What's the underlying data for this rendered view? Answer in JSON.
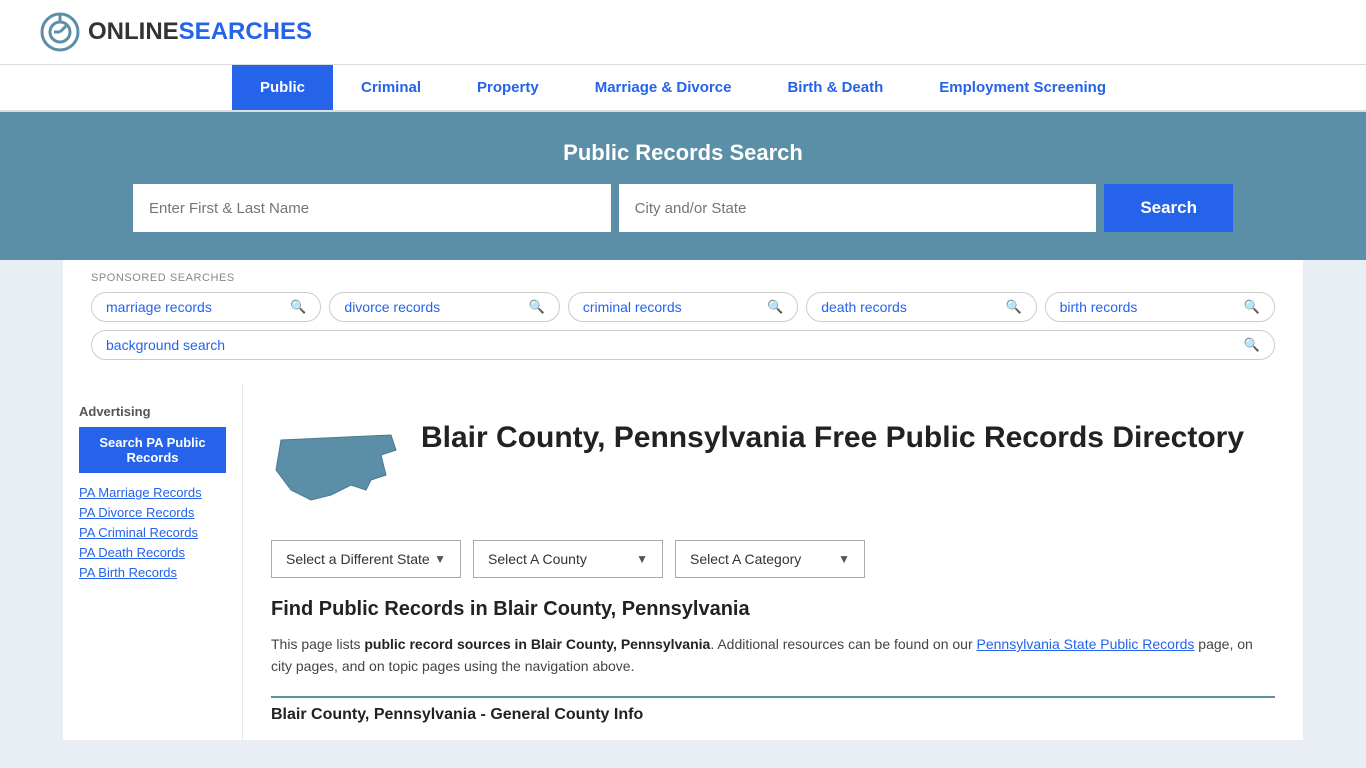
{
  "logo": {
    "text_online": "ONLINE",
    "text_searches": "SEARCHES"
  },
  "nav": {
    "items": [
      {
        "label": "Public",
        "active": true
      },
      {
        "label": "Criminal",
        "active": false
      },
      {
        "label": "Property",
        "active": false
      },
      {
        "label": "Marriage & Divorce",
        "active": false
      },
      {
        "label": "Birth & Death",
        "active": false
      },
      {
        "label": "Employment Screening",
        "active": false
      }
    ]
  },
  "hero": {
    "title": "Public Records Search",
    "name_placeholder": "Enter First & Last Name",
    "location_placeholder": "City and/or State",
    "search_button": "Search"
  },
  "sponsored": {
    "label": "SPONSORED SEARCHES",
    "pills": [
      "marriage records",
      "divorce records",
      "criminal records",
      "death records",
      "birth records",
      "background search"
    ]
  },
  "page": {
    "title": "Blair County, Pennsylvania Free Public Records Directory",
    "state_label": "Pennsylvania",
    "dropdowns": [
      {
        "label": "Select a Different State"
      },
      {
        "label": "Select A County"
      },
      {
        "label": "Select A Category"
      }
    ],
    "find_title": "Find Public Records in Blair County, Pennsylvania",
    "find_desc_plain": "This page lists ",
    "find_desc_bold": "public record sources in Blair County, Pennsylvania",
    "find_desc_mid": ". Additional resources can be found on our ",
    "find_desc_link": "Pennsylvania State Public Records",
    "find_desc_end": " page, on city pages, and on topic pages using the navigation above.",
    "bottom_heading": "Blair County, Pennsylvania - General County Info"
  },
  "sidebar": {
    "ad_label": "Advertising",
    "ad_button": "Search PA Public Records",
    "links": [
      "PA Marriage Records",
      "PA Divorce Records",
      "PA Criminal Records",
      "PA Death Records",
      "PA Birth Records"
    ]
  }
}
